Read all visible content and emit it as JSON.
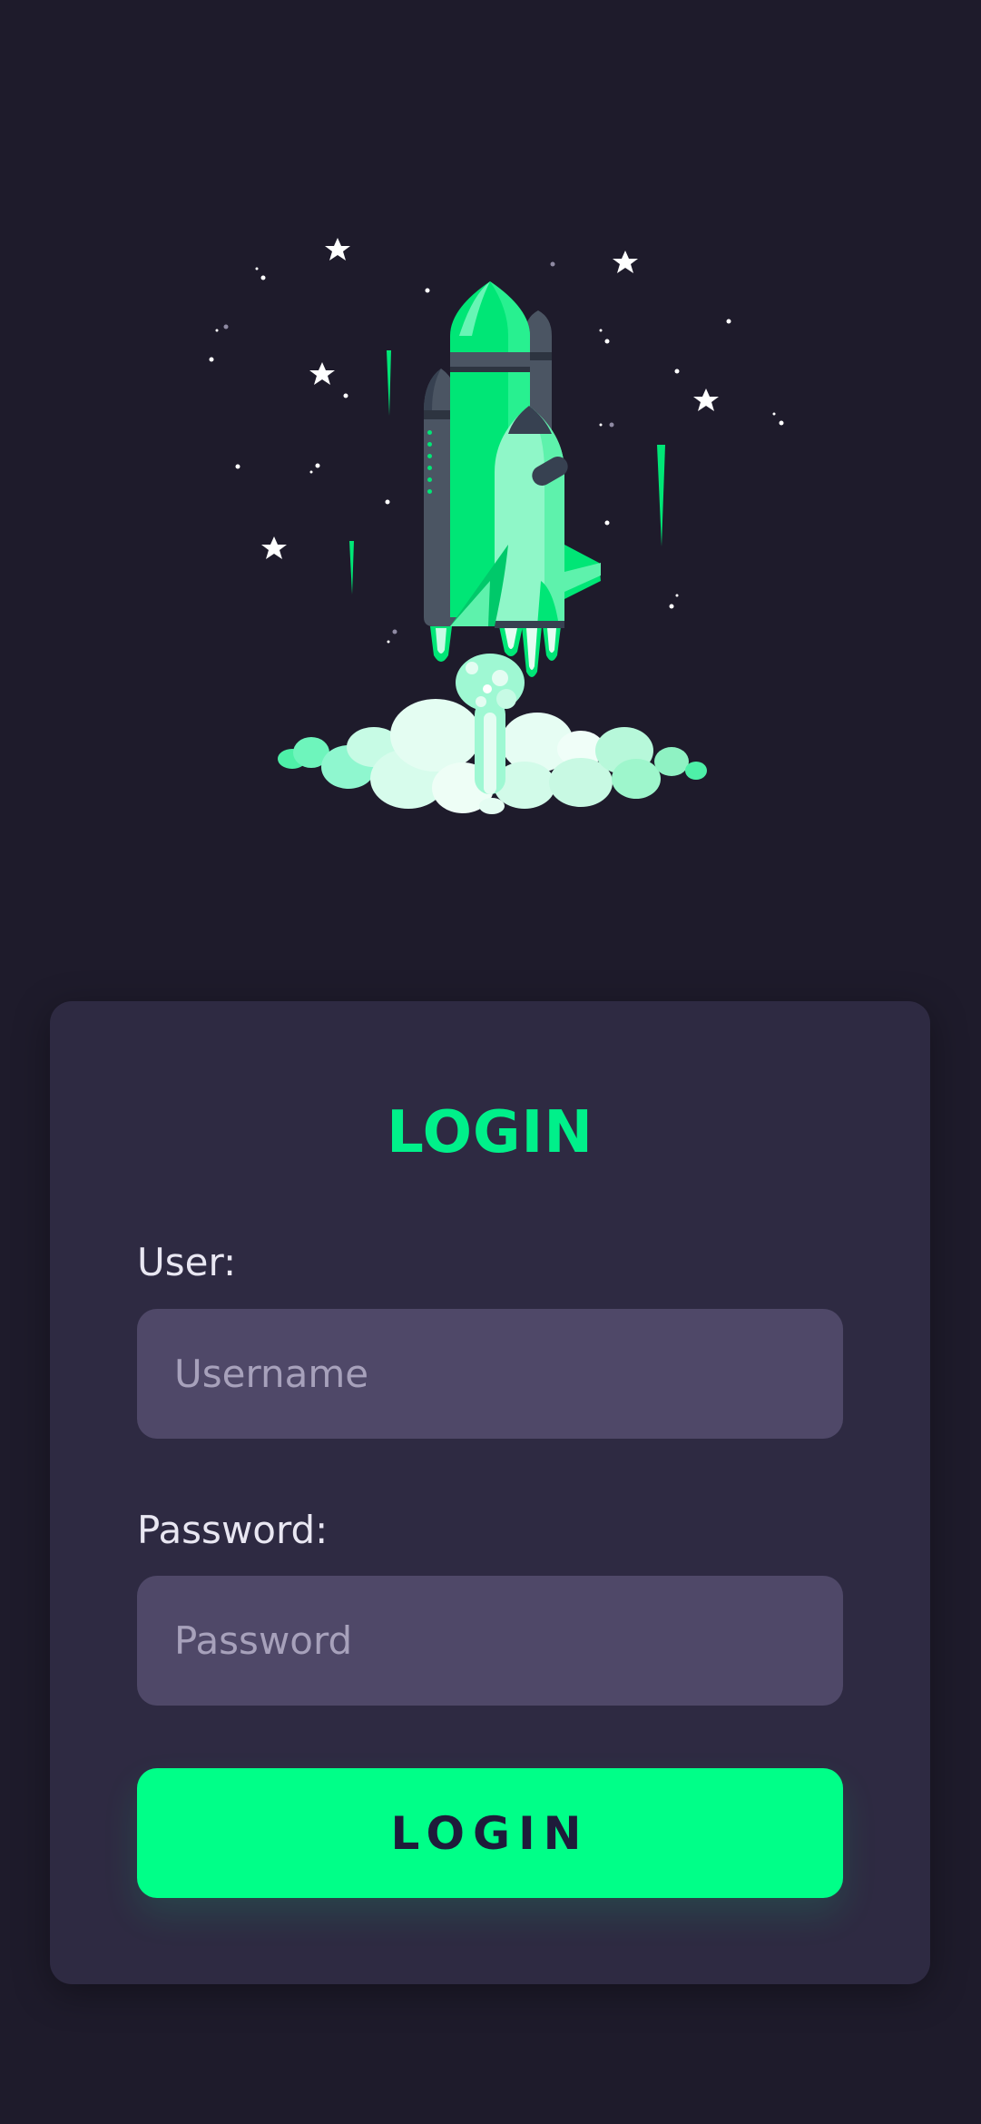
{
  "colors": {
    "background": "#1e1b2b",
    "card": "#2e2a42",
    "accent": "#00ff88",
    "input_background": "#4f4868",
    "button_text": "#1e1b3a"
  },
  "hero": {
    "icon": "rocket-launch-illustration"
  },
  "login_form": {
    "title": "LOGIN",
    "user_label": "User:",
    "username_placeholder": "Username",
    "username_value": "",
    "password_label": "Password:",
    "password_placeholder": "Password",
    "password_value": "",
    "submit_label": "LOGIN"
  }
}
